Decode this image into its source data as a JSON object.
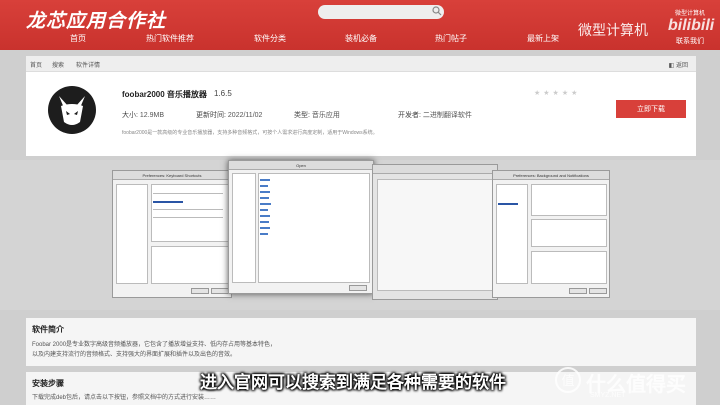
{
  "header": {
    "logo": "龙芯应用合作社",
    "search_placeholder": "",
    "nav": [
      "首页",
      "热门软件推荐",
      "软件分类",
      "装机必备",
      "热门帖子",
      "最新上架"
    ],
    "contact": "联系我们"
  },
  "overlay": {
    "channel_name": "微型计算机",
    "bili_label": "bilibili",
    "bili_top": "微型计算机",
    "subtitle": "进入官网可以搜索到满足各种需要的软件",
    "watermark": "什么值得买",
    "watermark_sub": "SMYZ.NET"
  },
  "breadcrumb": [
    "首页",
    "搜索",
    "软件详情"
  ],
  "back_label": "返回",
  "app": {
    "title": "foobar2000 音乐播放器",
    "version": "1.6.5",
    "size_label": "大小:",
    "size": "12.9MB",
    "updated_label": "更新时间:",
    "updated": "2022/11/02",
    "type_label": "类型:",
    "type": "音乐应用",
    "dev_label": "开发者:",
    "dev": "二进制翻译软件",
    "desc": "foobar2000是一款高级的专业音乐播放器，支持多种音频格式，可按个人需求进行高度定制，适用于Windows系统。",
    "download": "立即下载",
    "stars": "★★★★★"
  },
  "gallery": {
    "shot1_title": "Preferences: Keyboard Shortcuts",
    "shot2_title": "Open",
    "shot3_title": "Preferences: Background and Notifications"
  },
  "intro": {
    "title": "软件简介",
    "line1": "Foobar 2000是专业数字高级音频播放器，它包含了播放增益支持、低内存占用等基本特色，",
    "line2": "以及内建支持流行的音频格式、支持强大的界面扩展和插件以及出色的音效。"
  },
  "steps": {
    "title": "安装步骤",
    "text": "下载完成deb包后，请点击以下按钮，参照文档中的方式进行安装……"
  },
  "colors": {
    "accent": "#d8403a"
  }
}
